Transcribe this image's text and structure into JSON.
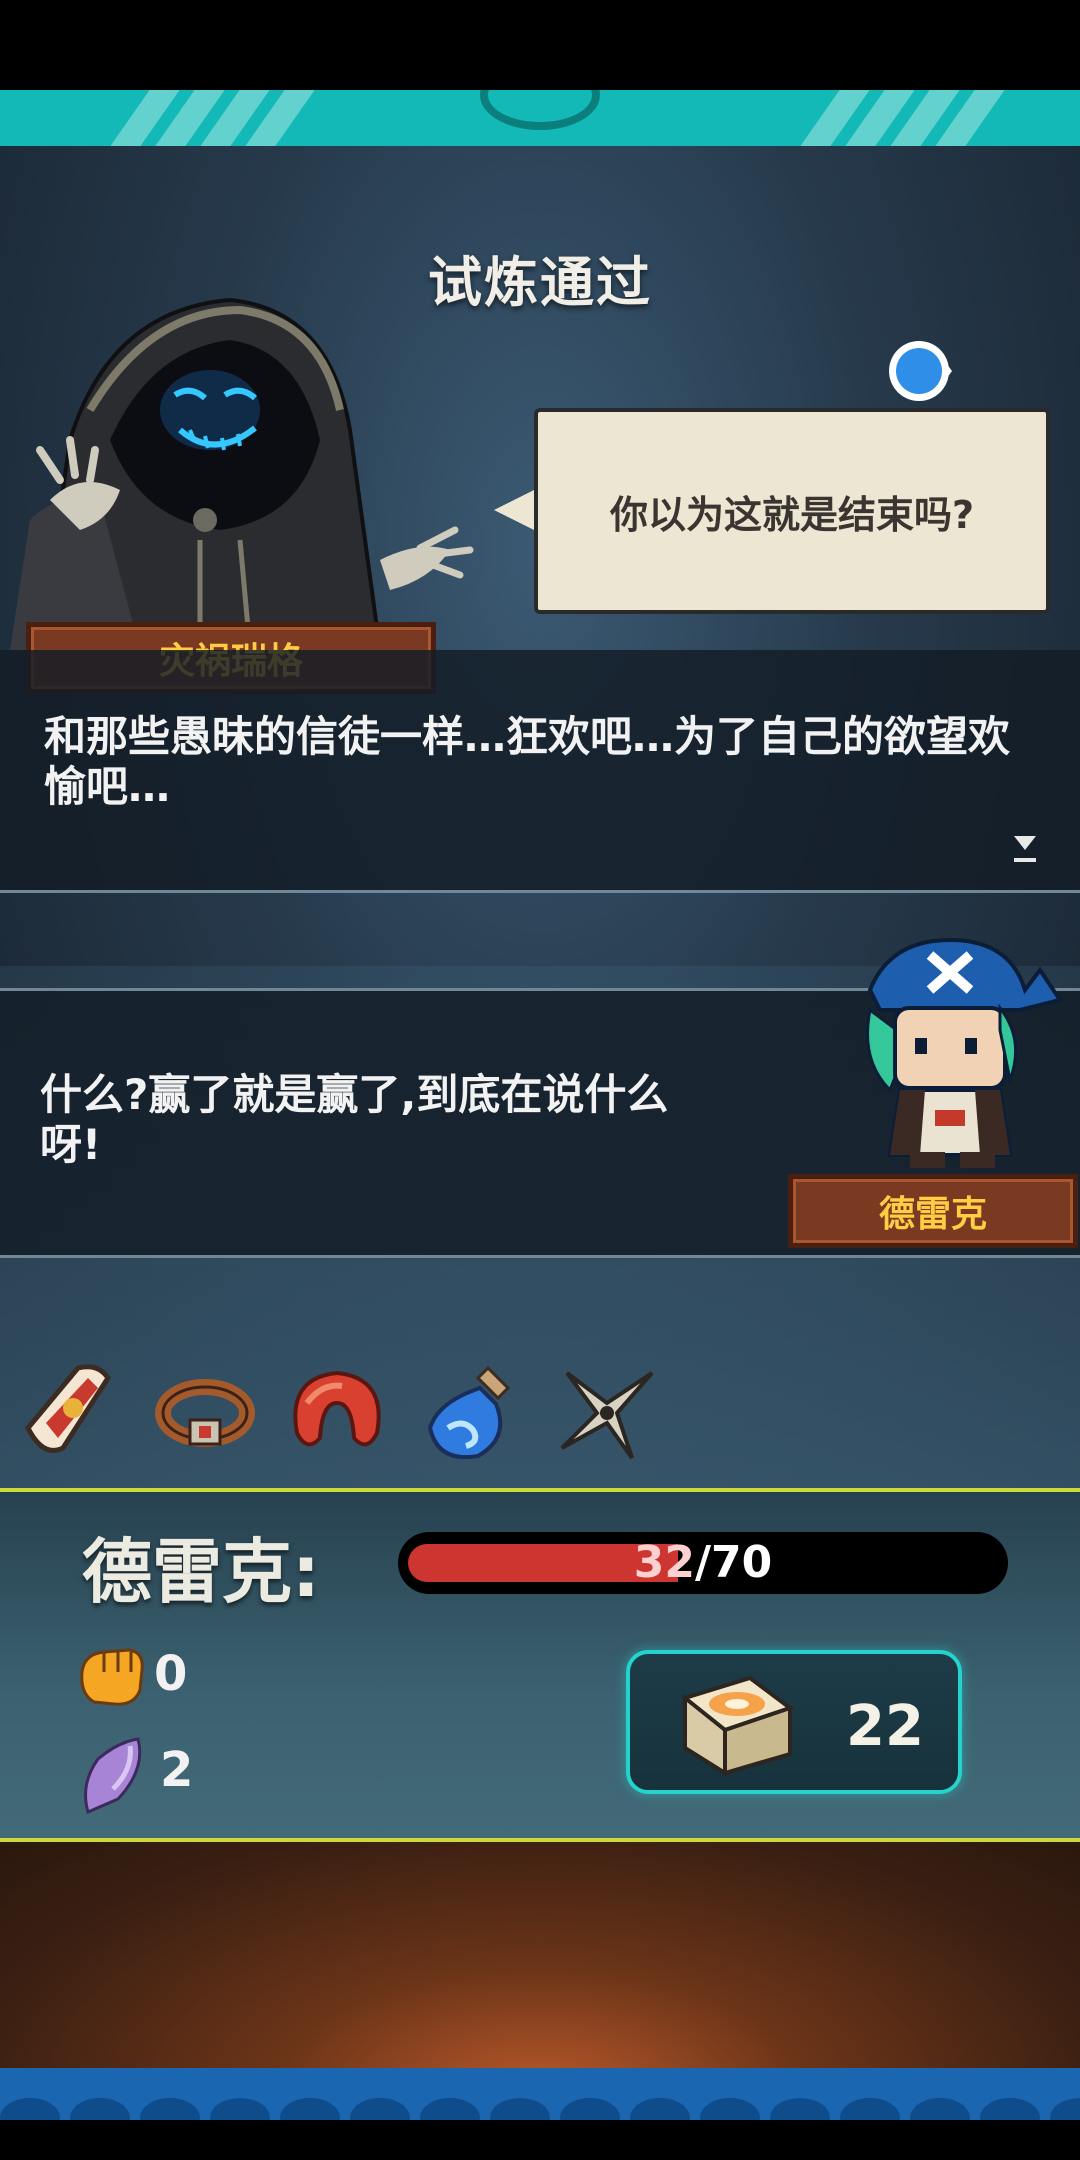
{
  "title": "试炼通过",
  "villain": {
    "name": "灾祸瑞格",
    "speech": "你以为这就是结束吗?"
  },
  "dialog1": {
    "text": "和那些愚昧的信徒一样…狂欢吧…为了自己的欲望欢愉吧…"
  },
  "dialog2": {
    "text": "什么?赢了就是赢了,到底在说什么呀!"
  },
  "hero": {
    "name": "德雷克"
  },
  "items": [
    "scroll-gauntlet",
    "belt",
    "red-cushion",
    "blue-potion",
    "shuriken"
  ],
  "stats": {
    "name": "德雷克:",
    "hp_current": "32",
    "hp_max": "/70",
    "hp_fraction": 0.457,
    "attack": "0",
    "shield": "2",
    "deck_count": "22"
  },
  "colors": {
    "accent": "#13b9b6",
    "plate": "#7a3a22",
    "plate_text": "#ffcc44",
    "hp": "#cc3530",
    "panel_border": "#cdd83a"
  }
}
